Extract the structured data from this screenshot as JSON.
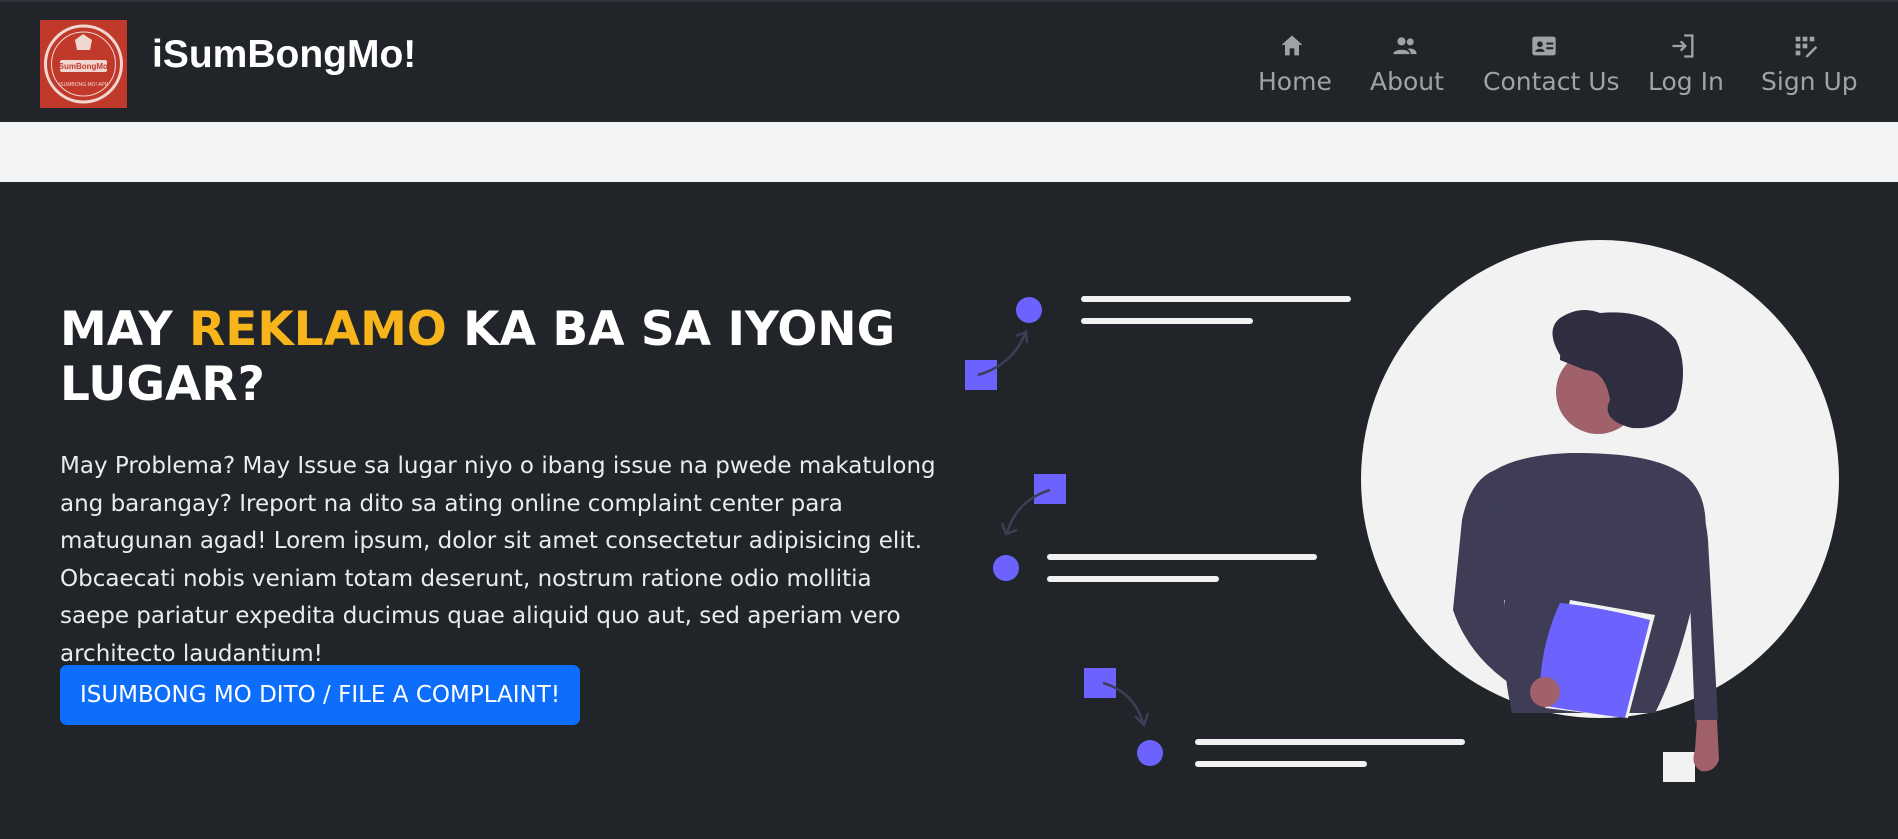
{
  "brand": {
    "name": "iSumBongMo!",
    "logo_text": "iSumBongMo!",
    "logo_subtext": "ISUMBONG MO! APP",
    "logo_color": "#c0392b"
  },
  "nav": {
    "items": [
      {
        "label": "Home",
        "icon": "home-icon"
      },
      {
        "label": "About",
        "icon": "users-icon"
      },
      {
        "label": "Contact Us",
        "icon": "contact-card-icon"
      },
      {
        "label": "Log In",
        "icon": "login-icon"
      },
      {
        "label": "Sign Up",
        "icon": "signup-icon"
      }
    ]
  },
  "hero": {
    "title_part1": "MAY ",
    "title_highlight": "REKLAMO",
    "title_part2": " KA BA SA IYONG LUGAR?",
    "lead": "May Problema? May Issue sa lugar niyo o ibang issue na pwede makatulong ang barangay? Ireport na dito sa ating online complaint center para matugunan agad! Lorem ipsum, dolor sit amet consectetur adipisicing elit. Obcaecati nobis veniam totam deserunt, nostrum ratione odio mollitia saepe pariatur expedita ducimus quae aliquid quo aut, sed aperiam vero architecto laudantium!",
    "cta_label": "ISUMBONG MO DITO / FILE A COMPLAINT!"
  },
  "colors": {
    "background": "#212529",
    "highlight": "#f8b41b",
    "primary_button": "#0d6efd",
    "accent": "#6c63ff",
    "strip": "#f3f4f6"
  }
}
